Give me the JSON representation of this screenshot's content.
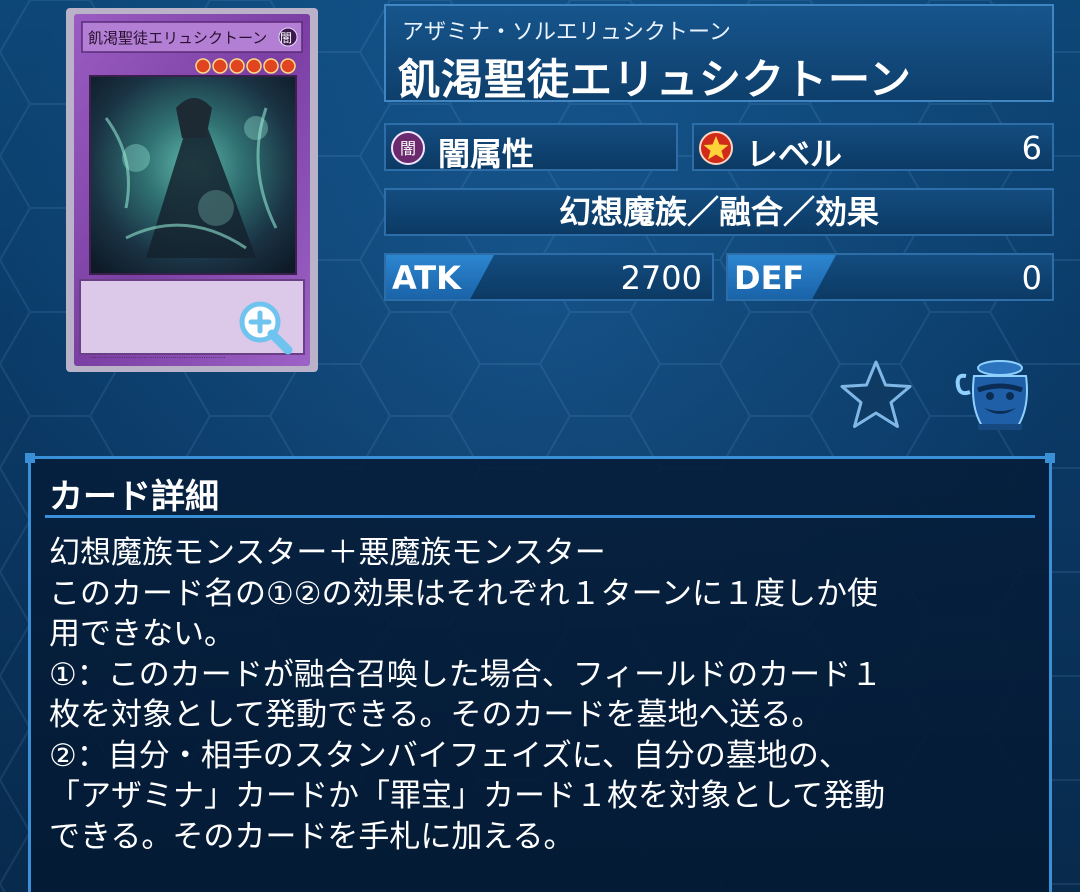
{
  "card": {
    "ruby": "アザミナ・ソルエリュシクトーン",
    "name": "飢渇聖徒エリュシクトーン",
    "thumbnail_title": "飢渇聖徒エリュシクトーン",
    "thumbnail_attribute_glyph": "闇",
    "thumbnail_level_stars": 6,
    "attribute": {
      "icon": "dark-attribute-icon",
      "glyph": "闇",
      "label": "闇属性"
    },
    "level": {
      "icon": "level-star-icon",
      "label": "レベル",
      "value": "6"
    },
    "type_line": "幻想魔族／融合／効果",
    "atk": {
      "label": "ATK",
      "value": "2700"
    },
    "def": {
      "label": "DEF",
      "value": "0"
    }
  },
  "actions": {
    "zoom_icon": "magnifier-plus-icon",
    "favorite_icon": "star-icon",
    "pot_icon": "pot-of-greed-icon"
  },
  "detail": {
    "title": "カード詳細",
    "lines": [
      "幻想魔族モンスター＋悪魔族モンスター",
      "このカード名の①②の効果はそれぞれ１ターンに１度しか使",
      "用できない。",
      "①：このカードが融合召喚した場合、フィールドのカード１",
      "枚を対象として発動できる。そのカードを墓地へ送る。",
      "②：自分・相手のスタンバイフェイズに、自分の墓地の、",
      "「アザミナ」カードか「罪宝」カード１枚を対象として発動",
      "できる。そのカードを手札に加える。"
    ]
  },
  "colors": {
    "background": "#0b3a66",
    "panel_border": "#3a90d6",
    "fusion_frame": "#8a4fb0",
    "accent_tab": "#2c86d0"
  }
}
